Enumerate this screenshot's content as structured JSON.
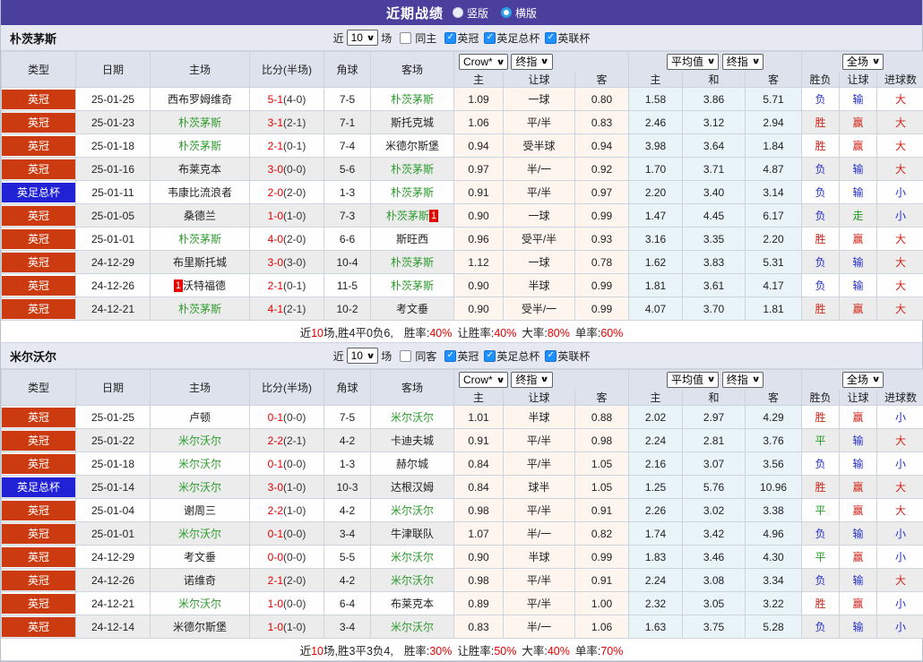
{
  "topbar": {
    "title": "近期战绩",
    "radios": [
      {
        "label": "竖版",
        "selected": false
      },
      {
        "label": "横版",
        "selected": true
      }
    ]
  },
  "controls": {
    "near": "近",
    "count": "10",
    "unit": "场",
    "odds_source": "Crow*",
    "final_odds": "终指",
    "average": "平均值",
    "fulltime": "全场"
  },
  "columns": {
    "type": "类型",
    "date": "日期",
    "home": "主场",
    "score": "比分(半场)",
    "corner": "角球",
    "away": "客场",
    "odds_home": "主",
    "odds_handicap": "让球",
    "odds_away": "客",
    "avg_home": "主",
    "avg_draw": "和",
    "avg_away": "客",
    "winloss": "胜负",
    "res_handicap": "让球",
    "goals": "进球数"
  },
  "colors": {
    "accent_purple": "#4b3f9e",
    "badge_red": "#cc3a10",
    "badge_blue": "#2121d6",
    "team_green": "#2e9b2e",
    "score_red": "#e60000",
    "result_red": "#d02418",
    "result_blue": "#2430c8",
    "result_green": "#1e9e1e"
  },
  "sections": [
    {
      "team": "朴茨茅斯",
      "filter": {
        "same": "同主",
        "same_checked": false,
        "leagues": [
          {
            "label": "英冠",
            "checked": true
          },
          {
            "label": "英足总杯",
            "checked": true
          },
          {
            "label": "英联杯",
            "checked": true
          }
        ]
      },
      "rows": [
        {
          "type": "英冠",
          "type_style": "red",
          "date": "25-01-25",
          "home": "西布罗姆维奇",
          "home_green": false,
          "score_ft": "5-1",
          "score_ht": "(4-0)",
          "corner": "7-5",
          "away": "朴茨茅斯",
          "away_green": true,
          "crow": [
            "1.09",
            "一球",
            "0.80"
          ],
          "avg": [
            "1.58",
            "3.86",
            "5.71"
          ],
          "results": [
            {
              "text": "负",
              "color": "blue"
            },
            {
              "text": "输",
              "color": "blue"
            },
            {
              "text": "大",
              "color": "red"
            }
          ]
        },
        {
          "type": "英冠",
          "type_style": "red",
          "date": "25-01-23",
          "home": "朴茨茅斯",
          "home_green": true,
          "score_ft": "3-1",
          "score_ht": "(2-1)",
          "corner": "7-1",
          "away": "斯托克城",
          "away_green": false,
          "crow": [
            "1.06",
            "平/半",
            "0.83"
          ],
          "avg": [
            "2.46",
            "3.12",
            "2.94"
          ],
          "results": [
            {
              "text": "胜",
              "color": "red"
            },
            {
              "text": "赢",
              "color": "red"
            },
            {
              "text": "大",
              "color": "red"
            }
          ]
        },
        {
          "type": "英冠",
          "type_style": "red",
          "date": "25-01-18",
          "home": "朴茨茅斯",
          "home_green": true,
          "score_ft": "2-1",
          "score_ht": "(0-1)",
          "corner": "7-4",
          "away": "米德尔斯堡",
          "away_green": false,
          "crow": [
            "0.94",
            "受半球",
            "0.94"
          ],
          "avg": [
            "3.98",
            "3.64",
            "1.84"
          ],
          "results": [
            {
              "text": "胜",
              "color": "red"
            },
            {
              "text": "赢",
              "color": "red"
            },
            {
              "text": "大",
              "color": "red"
            }
          ]
        },
        {
          "type": "英冠",
          "type_style": "red",
          "date": "25-01-16",
          "home": "布莱克本",
          "home_green": false,
          "score_ft": "3-0",
          "score_ht": "(0-0)",
          "corner": "5-6",
          "away": "朴茨茅斯",
          "away_green": true,
          "crow": [
            "0.97",
            "半/一",
            "0.92"
          ],
          "avg": [
            "1.70",
            "3.71",
            "4.87"
          ],
          "results": [
            {
              "text": "负",
              "color": "blue"
            },
            {
              "text": "输",
              "color": "blue"
            },
            {
              "text": "大",
              "color": "red"
            }
          ]
        },
        {
          "type": "英足总杯",
          "type_style": "blue",
          "date": "25-01-11",
          "home": "韦康比流浪者",
          "home_green": false,
          "score_ft": "2-0",
          "score_ht": "(2-0)",
          "corner": "1-3",
          "away": "朴茨茅斯",
          "away_green": true,
          "crow": [
            "0.91",
            "平/半",
            "0.97"
          ],
          "avg": [
            "2.20",
            "3.40",
            "3.14"
          ],
          "results": [
            {
              "text": "负",
              "color": "blue"
            },
            {
              "text": "输",
              "color": "blue"
            },
            {
              "text": "小",
              "color": "blue"
            }
          ]
        },
        {
          "type": "英冠",
          "type_style": "red",
          "date": "25-01-05",
          "home": "桑德兰",
          "home_green": false,
          "score_ft": "1-0",
          "score_ht": "(1-0)",
          "corner": "7-3",
          "away": "朴茨茅斯",
          "away_green": true,
          "away_badge": "1",
          "crow": [
            "0.90",
            "一球",
            "0.99"
          ],
          "avg": [
            "1.47",
            "4.45",
            "6.17"
          ],
          "results": [
            {
              "text": "负",
              "color": "blue"
            },
            {
              "text": "走",
              "color": "green"
            },
            {
              "text": "小",
              "color": "blue"
            }
          ]
        },
        {
          "type": "英冠",
          "type_style": "red",
          "date": "25-01-01",
          "home": "朴茨茅斯",
          "home_green": true,
          "score_ft": "4-0",
          "score_ht": "(2-0)",
          "corner": "6-6",
          "away": "斯旺西",
          "away_green": false,
          "crow": [
            "0.96",
            "受平/半",
            "0.93"
          ],
          "avg": [
            "3.16",
            "3.35",
            "2.20"
          ],
          "results": [
            {
              "text": "胜",
              "color": "red"
            },
            {
              "text": "赢",
              "color": "red"
            },
            {
              "text": "大",
              "color": "red"
            }
          ]
        },
        {
          "type": "英冠",
          "type_style": "red",
          "date": "24-12-29",
          "home": "布里斯托城",
          "home_green": false,
          "score_ft": "3-0",
          "score_ht": "(3-0)",
          "corner": "10-4",
          "away": "朴茨茅斯",
          "away_green": true,
          "crow": [
            "1.12",
            "一球",
            "0.78"
          ],
          "avg": [
            "1.62",
            "3.83",
            "5.31"
          ],
          "results": [
            {
              "text": "负",
              "color": "blue"
            },
            {
              "text": "输",
              "color": "blue"
            },
            {
              "text": "大",
              "color": "red"
            }
          ]
        },
        {
          "type": "英冠",
          "type_style": "red",
          "date": "24-12-26",
          "home": "沃特福德",
          "home_green": false,
          "home_badge": "1",
          "score_ft": "2-1",
          "score_ht": "(0-1)",
          "corner": "11-5",
          "away": "朴茨茅斯",
          "away_green": true,
          "crow": [
            "0.90",
            "半球",
            "0.99"
          ],
          "avg": [
            "1.81",
            "3.61",
            "4.17"
          ],
          "results": [
            {
              "text": "负",
              "color": "blue"
            },
            {
              "text": "输",
              "color": "blue"
            },
            {
              "text": "大",
              "color": "red"
            }
          ]
        },
        {
          "type": "英冠",
          "type_style": "red",
          "date": "24-12-21",
          "home": "朴茨茅斯",
          "home_green": true,
          "score_ft": "4-1",
          "score_ht": "(2-1)",
          "corner": "10-2",
          "away": "考文垂",
          "away_green": false,
          "crow": [
            "0.90",
            "受半/一",
            "0.99"
          ],
          "avg": [
            "4.07",
            "3.70",
            "1.81"
          ],
          "results": [
            {
              "text": "胜",
              "color": "red"
            },
            {
              "text": "赢",
              "color": "red"
            },
            {
              "text": "大",
              "color": "red"
            }
          ]
        }
      ],
      "summary": {
        "lead_pre": "近",
        "lead_num": "10",
        "lead_post": "场,胜4平0负6,",
        "stats": [
          {
            "label": "胜率:",
            "value": "40%"
          },
          {
            "label": "让胜率:",
            "value": "40%"
          },
          {
            "label": "大率:",
            "value": "80%"
          },
          {
            "label": "单率:",
            "value": "60%"
          }
        ]
      }
    },
    {
      "team": "米尔沃尔",
      "filter": {
        "same": "同客",
        "same_checked": false,
        "leagues": [
          {
            "label": "英冠",
            "checked": true
          },
          {
            "label": "英足总杯",
            "checked": true
          },
          {
            "label": "英联杯",
            "checked": true
          }
        ]
      },
      "rows": [
        {
          "type": "英冠",
          "type_style": "red",
          "date": "25-01-25",
          "home": "卢顿",
          "home_green": false,
          "score_ft": "0-1",
          "score_ht": "(0-0)",
          "corner": "7-5",
          "away": "米尔沃尔",
          "away_green": true,
          "crow": [
            "1.01",
            "半球",
            "0.88"
          ],
          "avg": [
            "2.02",
            "2.97",
            "4.29"
          ],
          "results": [
            {
              "text": "胜",
              "color": "red"
            },
            {
              "text": "赢",
              "color": "red"
            },
            {
              "text": "小",
              "color": "blue"
            }
          ]
        },
        {
          "type": "英冠",
          "type_style": "red",
          "date": "25-01-22",
          "home": "米尔沃尔",
          "home_green": true,
          "score_ft": "2-2",
          "score_ht": "(2-1)",
          "corner": "4-2",
          "away": "卡迪夫城",
          "away_green": false,
          "crow": [
            "0.91",
            "平/半",
            "0.98"
          ],
          "avg": [
            "2.24",
            "2.81",
            "3.76"
          ],
          "results": [
            {
              "text": "平",
              "color": "green"
            },
            {
              "text": "输",
              "color": "blue"
            },
            {
              "text": "大",
              "color": "red"
            }
          ]
        },
        {
          "type": "英冠",
          "type_style": "red",
          "date": "25-01-18",
          "home": "米尔沃尔",
          "home_green": true,
          "score_ft": "0-1",
          "score_ht": "(0-0)",
          "corner": "1-3",
          "away": "赫尔城",
          "away_green": false,
          "crow": [
            "0.84",
            "平/半",
            "1.05"
          ],
          "avg": [
            "2.16",
            "3.07",
            "3.56"
          ],
          "results": [
            {
              "text": "负",
              "color": "blue"
            },
            {
              "text": "输",
              "color": "blue"
            },
            {
              "text": "小",
              "color": "blue"
            }
          ]
        },
        {
          "type": "英足总杯",
          "type_style": "blue",
          "date": "25-01-14",
          "home": "米尔沃尔",
          "home_green": true,
          "score_ft": "3-0",
          "score_ht": "(1-0)",
          "corner": "10-3",
          "away": "达根汉姆",
          "away_green": false,
          "crow": [
            "0.84",
            "球半",
            "1.05"
          ],
          "avg": [
            "1.25",
            "5.76",
            "10.96"
          ],
          "results": [
            {
              "text": "胜",
              "color": "red"
            },
            {
              "text": "赢",
              "color": "red"
            },
            {
              "text": "大",
              "color": "red"
            }
          ]
        },
        {
          "type": "英冠",
          "type_style": "red",
          "date": "25-01-04",
          "home": "谢周三",
          "home_green": false,
          "score_ft": "2-2",
          "score_ht": "(1-0)",
          "corner": "4-2",
          "away": "米尔沃尔",
          "away_green": true,
          "crow": [
            "0.98",
            "平/半",
            "0.91"
          ],
          "avg": [
            "2.26",
            "3.02",
            "3.38"
          ],
          "results": [
            {
              "text": "平",
              "color": "green"
            },
            {
              "text": "赢",
              "color": "red"
            },
            {
              "text": "大",
              "color": "red"
            }
          ]
        },
        {
          "type": "英冠",
          "type_style": "red",
          "date": "25-01-01",
          "home": "米尔沃尔",
          "home_green": true,
          "score_ft": "0-1",
          "score_ht": "(0-0)",
          "corner": "3-4",
          "away": "牛津联队",
          "away_green": false,
          "crow": [
            "1.07",
            "半/一",
            "0.82"
          ],
          "avg": [
            "1.74",
            "3.42",
            "4.96"
          ],
          "results": [
            {
              "text": "负",
              "color": "blue"
            },
            {
              "text": "输",
              "color": "blue"
            },
            {
              "text": "小",
              "color": "blue"
            }
          ]
        },
        {
          "type": "英冠",
          "type_style": "red",
          "date": "24-12-29",
          "home": "考文垂",
          "home_green": false,
          "score_ft": "0-0",
          "score_ht": "(0-0)",
          "corner": "5-5",
          "away": "米尔沃尔",
          "away_green": true,
          "crow": [
            "0.90",
            "半球",
            "0.99"
          ],
          "avg": [
            "1.83",
            "3.46",
            "4.30"
          ],
          "results": [
            {
              "text": "平",
              "color": "green"
            },
            {
              "text": "赢",
              "color": "red"
            },
            {
              "text": "小",
              "color": "blue"
            }
          ]
        },
        {
          "type": "英冠",
          "type_style": "red",
          "date": "24-12-26",
          "home": "诺维奇",
          "home_green": false,
          "score_ft": "2-1",
          "score_ht": "(2-0)",
          "corner": "4-2",
          "away": "米尔沃尔",
          "away_green": true,
          "crow": [
            "0.98",
            "平/半",
            "0.91"
          ],
          "avg": [
            "2.24",
            "3.08",
            "3.34"
          ],
          "results": [
            {
              "text": "负",
              "color": "blue"
            },
            {
              "text": "输",
              "color": "blue"
            },
            {
              "text": "大",
              "color": "red"
            }
          ]
        },
        {
          "type": "英冠",
          "type_style": "red",
          "date": "24-12-21",
          "home": "米尔沃尔",
          "home_green": true,
          "score_ft": "1-0",
          "score_ht": "(0-0)",
          "corner": "6-4",
          "away": "布莱克本",
          "away_green": false,
          "crow": [
            "0.89",
            "平/半",
            "1.00"
          ],
          "avg": [
            "2.32",
            "3.05",
            "3.22"
          ],
          "results": [
            {
              "text": "胜",
              "color": "red"
            },
            {
              "text": "赢",
              "color": "red"
            },
            {
              "text": "小",
              "color": "blue"
            }
          ]
        },
        {
          "type": "英冠",
          "type_style": "red",
          "date": "24-12-14",
          "home": "米德尔斯堡",
          "home_green": false,
          "score_ft": "1-0",
          "score_ht": "(1-0)",
          "corner": "3-4",
          "away": "米尔沃尔",
          "away_green": true,
          "crow": [
            "0.83",
            "半/一",
            "1.06"
          ],
          "avg": [
            "1.63",
            "3.75",
            "5.28"
          ],
          "results": [
            {
              "text": "负",
              "color": "blue"
            },
            {
              "text": "输",
              "color": "blue"
            },
            {
              "text": "小",
              "color": "blue"
            }
          ]
        }
      ],
      "summary": {
        "lead_pre": "近",
        "lead_num": "10",
        "lead_post": "场,胜3平3负4,",
        "stats": [
          {
            "label": "胜率:",
            "value": "30%"
          },
          {
            "label": "让胜率:",
            "value": "50%"
          },
          {
            "label": "大率:",
            "value": "40%"
          },
          {
            "label": "单率:",
            "value": "70%"
          }
        ]
      }
    }
  ]
}
